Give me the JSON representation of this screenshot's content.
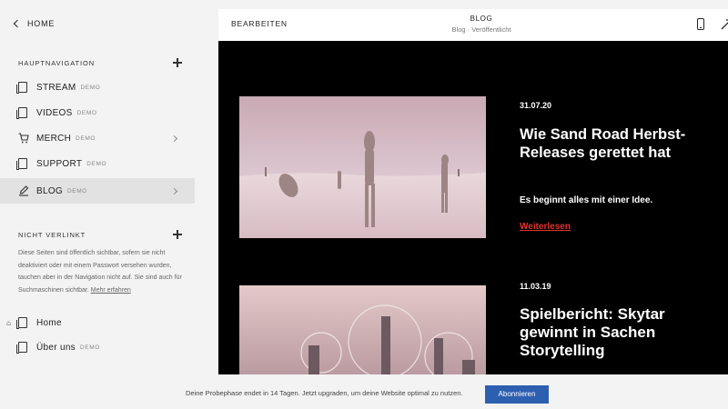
{
  "sidebar": {
    "back_label": "HOME",
    "main_nav_title": "HAUPTNAVIGATION",
    "items": [
      {
        "label": "STREAM",
        "badge": "DEMO"
      },
      {
        "label": "VIDEOS",
        "badge": "DEMO"
      },
      {
        "label": "MERCH",
        "badge": "DEMO"
      },
      {
        "label": "SUPPORT",
        "badge": "DEMO"
      },
      {
        "label": "BLOG",
        "badge": "DEMO"
      }
    ],
    "unlinked_title": "NICHT VERLINKT",
    "unlinked_desc": "Diese Seiten sind öffentlich sichtbar, sofern sie nicht deaktiviert oder mit einem Passwort versehen wurden, tauchen aber in der Navigation nicht auf. Sie sind auch für Suchmaschinen sichtbar.",
    "unlinked_link": "Mehr erfahren",
    "unlinked_items": [
      {
        "label": "Home",
        "badge": ""
      },
      {
        "label": "Über uns",
        "badge": "DEMO"
      }
    ]
  },
  "preview": {
    "edit_label": "BEARBEITEN",
    "page_title": "BLOG",
    "page_status": "Blog · Veröffentlicht",
    "posts": [
      {
        "date": "31.07.20",
        "title": "Wie Sand Road Herbst-Releases gerettet hat",
        "excerpt": "Es beginnt alles mit einer Idee.",
        "more": "Weiterlesen"
      },
      {
        "date": "11.03.19",
        "title": "Spielbericht: Skytar gewinnt in Sachen Storytelling",
        "excerpt": "",
        "more": ""
      }
    ]
  },
  "trial": {
    "text": "Deine Probephase endet in 14 Tagen. Jetzt upgraden, um deine Website optimal zu nutzen.",
    "button": "Abonnieren"
  },
  "colors": {
    "accent": "#e0322d",
    "primary_button": "#2d5fb0",
    "active_item": "#e2e2e2"
  }
}
